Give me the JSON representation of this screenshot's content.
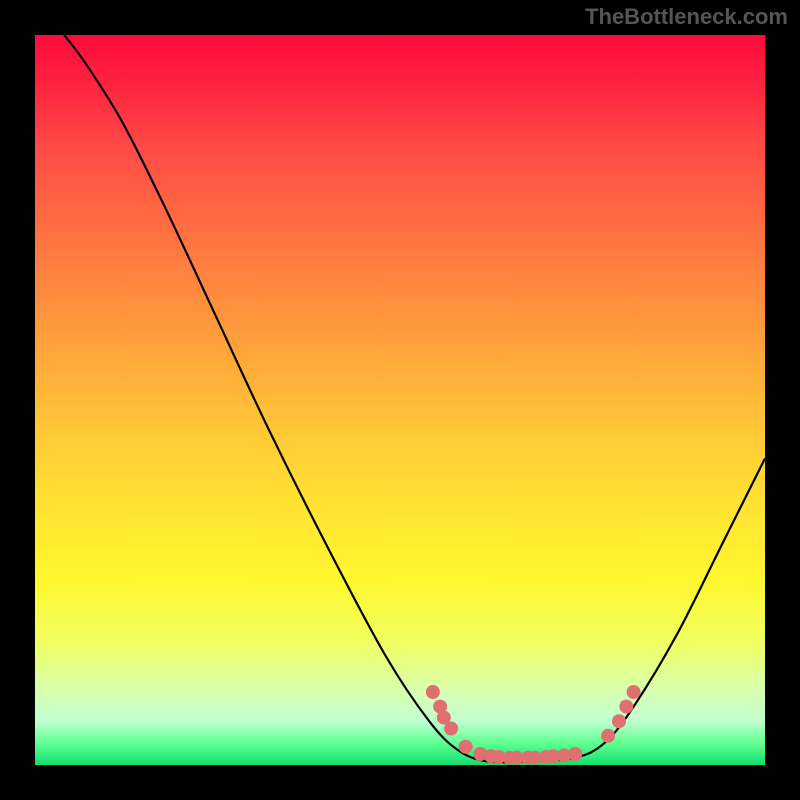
{
  "watermark": "TheBottleneck.com",
  "chart_data": {
    "type": "line",
    "title": "",
    "xlabel": "",
    "ylabel": "",
    "xlim": [
      0,
      100
    ],
    "ylim": [
      0,
      100
    ],
    "curve": [
      {
        "x": 4,
        "y": 100
      },
      {
        "x": 7,
        "y": 96
      },
      {
        "x": 12,
        "y": 88
      },
      {
        "x": 18,
        "y": 76
      },
      {
        "x": 25,
        "y": 61
      },
      {
        "x": 32,
        "y": 46
      },
      {
        "x": 40,
        "y": 30
      },
      {
        "x": 48,
        "y": 15
      },
      {
        "x": 54,
        "y": 6
      },
      {
        "x": 58,
        "y": 2
      },
      {
        "x": 62,
        "y": 0.5
      },
      {
        "x": 68,
        "y": 0.5
      },
      {
        "x": 74,
        "y": 1
      },
      {
        "x": 78,
        "y": 3
      },
      {
        "x": 82,
        "y": 8
      },
      {
        "x": 88,
        "y": 18
      },
      {
        "x": 94,
        "y": 30
      },
      {
        "x": 100,
        "y": 42
      }
    ],
    "dots": [
      {
        "x": 54.5,
        "y": 10
      },
      {
        "x": 55.5,
        "y": 8
      },
      {
        "x": 56,
        "y": 6.5
      },
      {
        "x": 57,
        "y": 5
      },
      {
        "x": 59,
        "y": 2.5
      },
      {
        "x": 61,
        "y": 1.5
      },
      {
        "x": 62.5,
        "y": 1.2
      },
      {
        "x": 63.5,
        "y": 1.1
      },
      {
        "x": 65,
        "y": 1.0
      },
      {
        "x": 66,
        "y": 1.0
      },
      {
        "x": 67.5,
        "y": 1.0
      },
      {
        "x": 68.5,
        "y": 1.0
      },
      {
        "x": 70,
        "y": 1.1
      },
      {
        "x": 71,
        "y": 1.2
      },
      {
        "x": 72.5,
        "y": 1.3
      },
      {
        "x": 74,
        "y": 1.5
      },
      {
        "x": 78.5,
        "y": 4
      },
      {
        "x": 80,
        "y": 6
      },
      {
        "x": 81,
        "y": 8
      },
      {
        "x": 82,
        "y": 10
      }
    ]
  }
}
